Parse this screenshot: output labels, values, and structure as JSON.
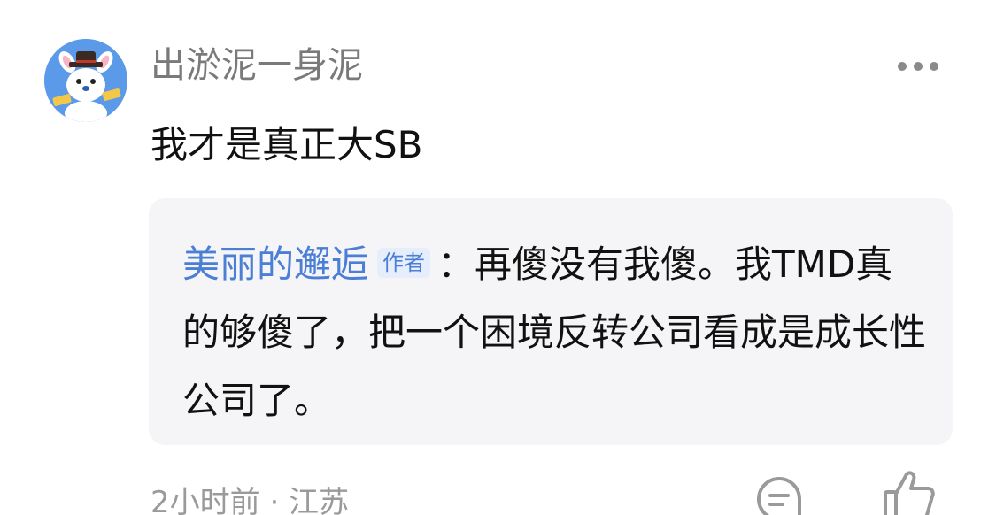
{
  "comment": {
    "username": "出淤泥一身泥",
    "text": "我才是真正大SB",
    "avatar_icon": "cartoon-rabbit-avatar-icon",
    "more_icon": "more-dots-icon"
  },
  "quote": {
    "author": "美丽的邂逅",
    "badge": "作者",
    "separator": "：",
    "text": "再傻没有我傻。我TMD真的够傻了，把一个困境反转公司看成是成长性公司了。"
  },
  "meta": {
    "time": "2小时前",
    "dot": "·",
    "location": "江苏"
  },
  "actions": {
    "reply_icon": "comment-icon",
    "like_icon": "thumbs-up-icon"
  },
  "colors": {
    "username": "#7a7a7a",
    "author_link": "#4b7fd6",
    "quote_background": "#f5f5f7",
    "meta": "#9a9a9a"
  }
}
